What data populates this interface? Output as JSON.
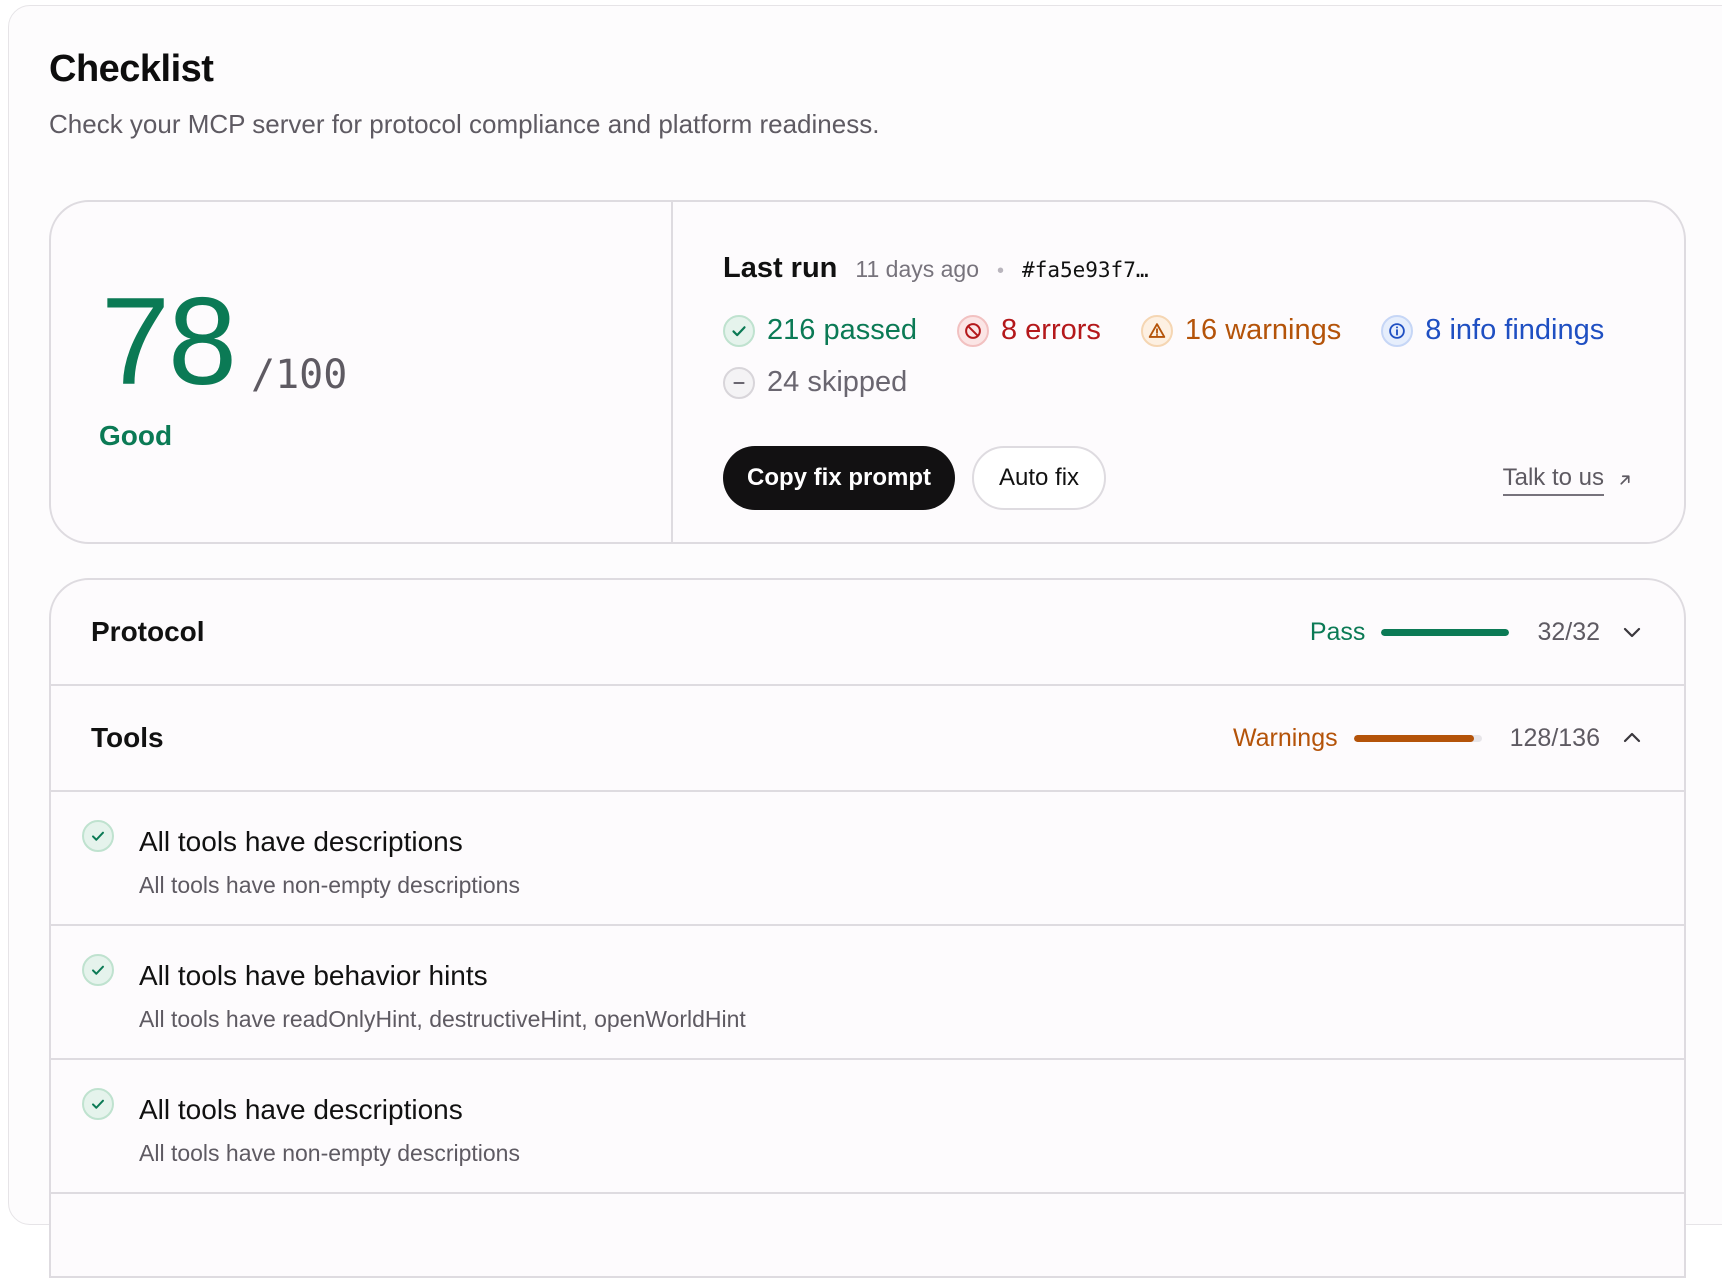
{
  "header": {
    "title": "Checklist",
    "subtitle": "Check your MCP server for protocol compliance and platform readiness."
  },
  "score": {
    "value": "78",
    "max": "/100",
    "grade": "Good",
    "color": "#0b7a55"
  },
  "last_run": {
    "label": "Last run",
    "time": "11 days ago",
    "separator": "•",
    "hash": "#fa5e93f7…"
  },
  "stats": {
    "passed": "216 passed",
    "errors": "8 errors",
    "warnings": "16 warnings",
    "info": "8 info findings",
    "skipped": "24 skipped"
  },
  "actions": {
    "copy_fix_prompt": "Copy fix prompt",
    "auto_fix": "Auto fix",
    "talk_to_us": "Talk to us"
  },
  "sections": [
    {
      "title": "Protocol",
      "status": "Pass",
      "count": "32/32",
      "progress": 1.0,
      "color": "#0b7a55",
      "expanded": false
    },
    {
      "title": "Tools",
      "status": "Warnings",
      "count": "128/136",
      "progress": 0.941,
      "color": "#b45309",
      "expanded": true
    }
  ],
  "checks": [
    {
      "title": "All tools have descriptions",
      "description": "All tools have non-empty descriptions",
      "status": "passed"
    },
    {
      "title": "All tools have behavior hints",
      "description": "All tools have readOnlyHint, destructiveHint, openWorldHint",
      "status": "passed"
    },
    {
      "title": "All tools have descriptions",
      "description": "All tools have non-empty descriptions",
      "status": "passed"
    }
  ],
  "icons": {
    "passed": "check-circle-icon",
    "errors": "ban-circle-icon",
    "warnings": "warning-triangle-icon",
    "info": "info-circle-icon",
    "skipped": "minus-circle-icon",
    "external": "arrow-up-right-icon",
    "collapse": "chevron-up-icon",
    "expand": "chevron-down-icon"
  }
}
